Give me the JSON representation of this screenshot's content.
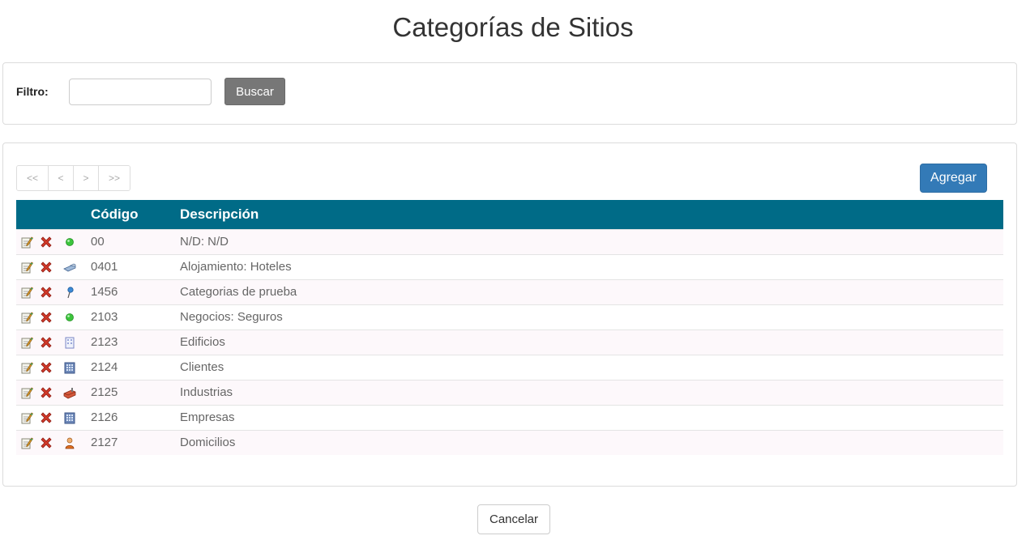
{
  "page": {
    "title": "Categorías de Sitios"
  },
  "filter": {
    "label": "Filtro:",
    "value": "",
    "placeholder": "",
    "search_label": "Buscar"
  },
  "pager": {
    "first": "<<",
    "prev": "<",
    "next": ">",
    "last": ">>"
  },
  "toolbar": {
    "add_label": "Agregar"
  },
  "table": {
    "headers": {
      "code": "Código",
      "description": "Descripción"
    },
    "rows": [
      {
        "code": "00",
        "description": "N/D: N/D",
        "icon": "green-dot-icon"
      },
      {
        "code": "0401",
        "description": "Alojamiento: Hoteles",
        "icon": "bed-icon"
      },
      {
        "code": "1456",
        "description": "Categorias de prueba",
        "icon": "pin-icon"
      },
      {
        "code": "2103",
        "description": "Negocios: Seguros",
        "icon": "green-dot-icon"
      },
      {
        "code": "2123",
        "description": "Edificios",
        "icon": "building-outline-icon"
      },
      {
        "code": "2124",
        "description": "Clientes",
        "icon": "building-icon"
      },
      {
        "code": "2125",
        "description": "Industrias",
        "icon": "factory-icon"
      },
      {
        "code": "2126",
        "description": "Empresas",
        "icon": "building-icon"
      },
      {
        "code": "2127",
        "description": "Domicilios",
        "icon": "person-icon"
      }
    ]
  },
  "footer": {
    "cancel_label": "Cancelar"
  },
  "colors": {
    "header_bg": "#006b87",
    "primary": "#337ab7",
    "search_btn": "#777777",
    "delete": "#c9302c"
  }
}
